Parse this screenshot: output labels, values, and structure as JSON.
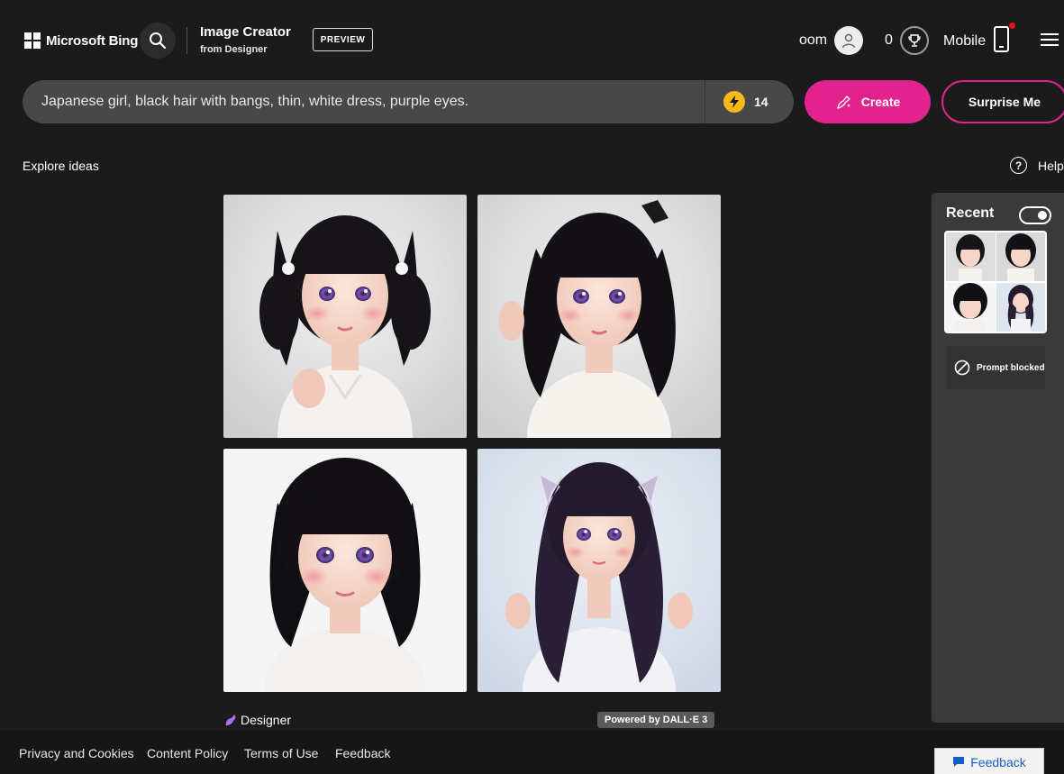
{
  "header": {
    "brand": "Microsoft Bing",
    "app_title": "Image Creator",
    "app_subtitle": "from Designer",
    "badge": "PREVIEW",
    "user_name": "oom",
    "reward_count": "0",
    "mobile_label": "Mobile"
  },
  "prompt": {
    "value": "Japanese girl, black hair with bangs, thin, white dress, purple eyes.",
    "boost_count": "14",
    "create_label": "Create",
    "surprise_label": "Surprise Me"
  },
  "nav": {
    "explore_label": "Explore ideas",
    "help_label": "Help"
  },
  "results": {
    "images": [
      {
        "name": "generated-image-1",
        "variant": "twin-tails"
      },
      {
        "name": "generated-image-2",
        "variant": "bob-hairclip"
      },
      {
        "name": "generated-image-3",
        "variant": "straight-bob"
      },
      {
        "name": "generated-image-4",
        "variant": "wavy-ribbons"
      }
    ],
    "designer_label": "Designer",
    "powered_label": "Powered by DALL·E 3"
  },
  "recent": {
    "title": "Recent",
    "toggle_on": true,
    "blocked_label": "Prompt blocked"
  },
  "footer": {
    "links": [
      "Privacy and Cookies",
      "Content Policy",
      "Terms of Use",
      "Feedback"
    ],
    "feedback_button": "Feedback"
  },
  "colors": {
    "background": "#1b1b1b",
    "accent": "#e3238d",
    "prompt_bar": "#484848",
    "boost": "#f5b919",
    "panel": "#3a3a3a"
  }
}
